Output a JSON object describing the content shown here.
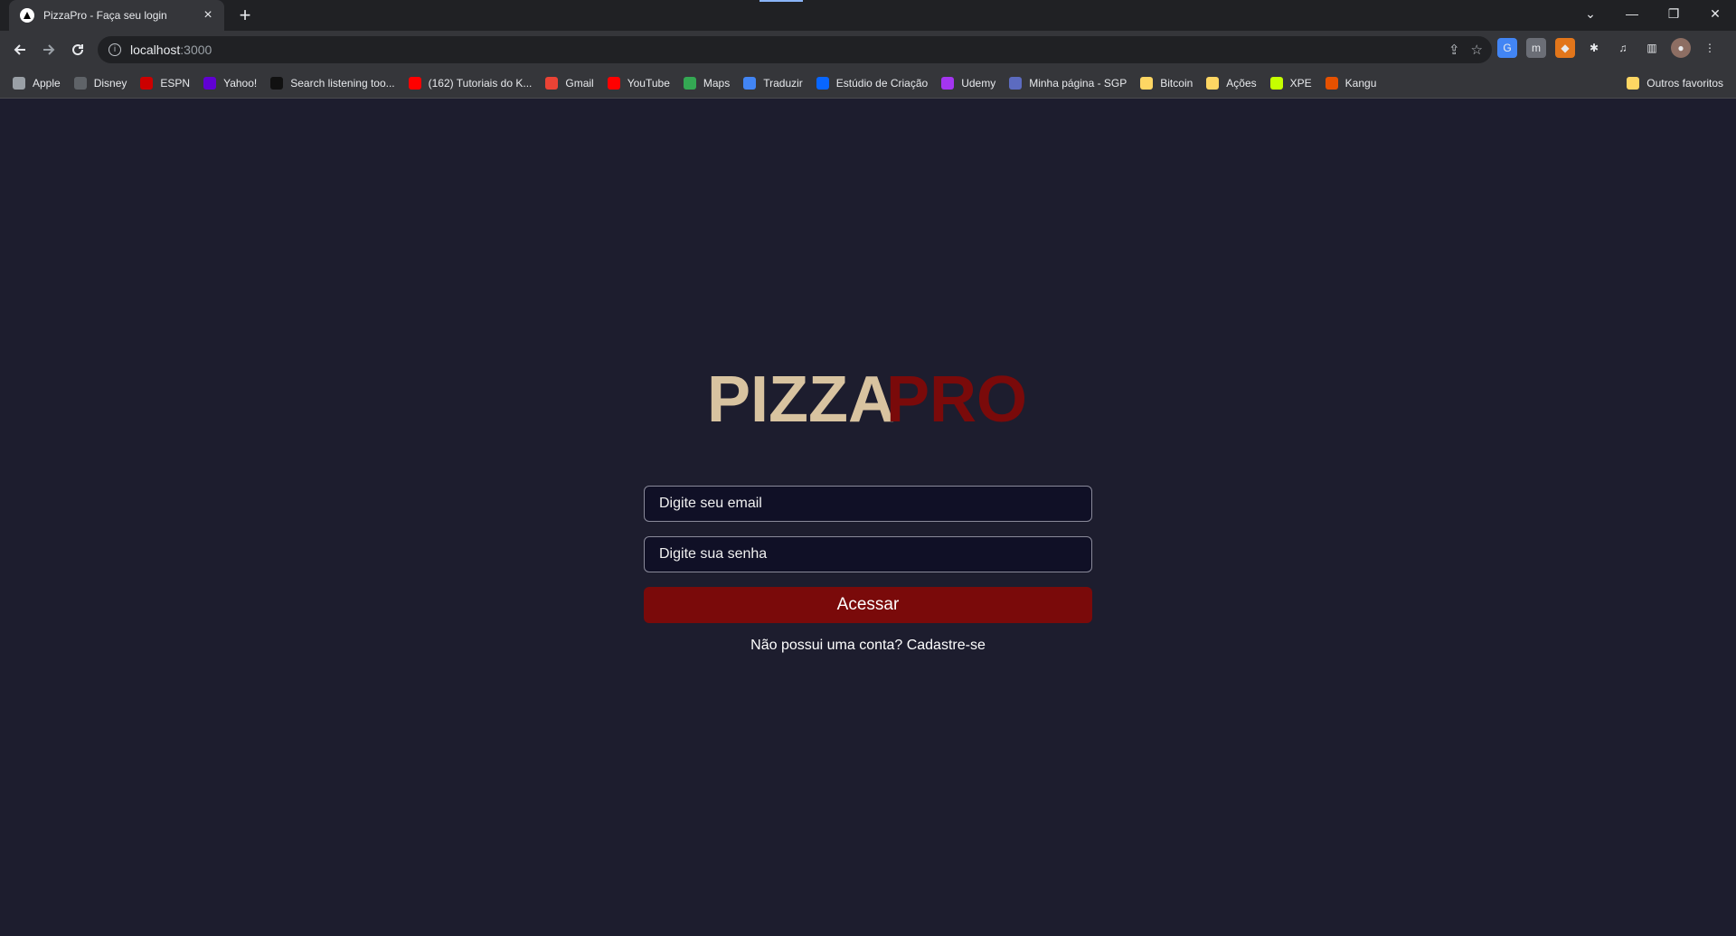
{
  "browser": {
    "tab_title": "PizzaPro - Faça seu login",
    "tab_close": "×",
    "new_tab": "+",
    "url_host": "localhost",
    "url_port": ":3000",
    "window_controls": {
      "minimize": "—",
      "restore": "❐",
      "close": "✕",
      "tab_search": "⌄"
    }
  },
  "bookmarks": [
    {
      "label": "Apple",
      "icon": "apple-icon",
      "color": "#9aa0a6"
    },
    {
      "label": "Disney",
      "icon": "disney-icon",
      "color": "#5f6368"
    },
    {
      "label": "ESPN",
      "icon": "espn-icon",
      "color": "#cc0000"
    },
    {
      "label": "Yahoo!",
      "icon": "yahoo-icon",
      "color": "#6001d2"
    },
    {
      "label": "Search listening too...",
      "icon": "search-listening-icon",
      "color": "#111111"
    },
    {
      "label": "(162) Tutoriais do K...",
      "icon": "youtube-icon",
      "color": "#ff0000"
    },
    {
      "label": "Gmail",
      "icon": "gmail-icon",
      "color": "#ea4335"
    },
    {
      "label": "YouTube",
      "icon": "youtube-icon",
      "color": "#ff0000"
    },
    {
      "label": "Maps",
      "icon": "maps-icon",
      "color": "#34a853"
    },
    {
      "label": "Traduzir",
      "icon": "translate-icon",
      "color": "#4285f4"
    },
    {
      "label": "Estúdio de Criação",
      "icon": "meta-icon",
      "color": "#0866ff"
    },
    {
      "label": "Udemy",
      "icon": "udemy-icon",
      "color": "#a435f0"
    },
    {
      "label": "Minha página - SGP",
      "icon": "sgp-icon",
      "color": "#5c6bc0"
    },
    {
      "label": "Bitcoin",
      "icon": "folder-icon",
      "color": "#fdd663"
    },
    {
      "label": "Ações",
      "icon": "folder-icon",
      "color": "#fdd663"
    },
    {
      "label": "XPE",
      "icon": "xpe-icon",
      "color": "#c6ff00"
    },
    {
      "label": "Kangu",
      "icon": "kangu-icon",
      "color": "#e65100"
    }
  ],
  "bookmarks_other": {
    "label": "Outros favoritos",
    "icon": "folder-icon",
    "color": "#fdd663"
  },
  "login": {
    "logo_left": "PIZZA",
    "logo_right": "PRO",
    "logo_left_color": "#d8c3a0",
    "logo_right_color": "#7a0a0a",
    "email_placeholder": "Digite seu email",
    "password_placeholder": "Digite sua senha",
    "submit_label": "Acessar",
    "signup_text": "Não possui uma conta? Cadastre-se"
  },
  "colors": {
    "page_background": "#1d1d2e",
    "button_background": "#7a0a0a",
    "input_background": "#101026"
  }
}
